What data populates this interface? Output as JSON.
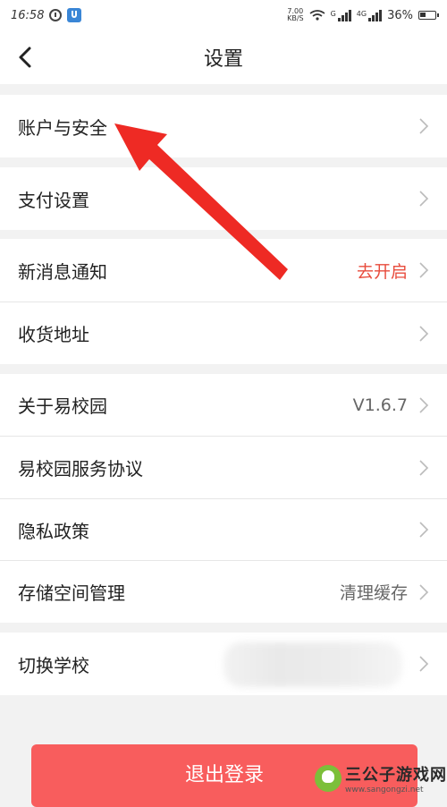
{
  "status_bar": {
    "time": "16:58",
    "net_speed": "7.00",
    "net_unit": "KB/S",
    "sig1": "G",
    "sig2": "4G",
    "battery": "36%"
  },
  "header": {
    "title": "设置"
  },
  "groups": [
    [
      {
        "label": "账户与安全",
        "value": ""
      }
    ],
    [
      {
        "label": "支付设置",
        "value": ""
      }
    ],
    [
      {
        "label": "新消息通知",
        "value": "去开启"
      },
      {
        "label": "收货地址",
        "value": ""
      }
    ],
    [
      {
        "label": "关于易校园",
        "value": "V1.6.7"
      },
      {
        "label": "易校园服务协议",
        "value": ""
      },
      {
        "label": "隐私政策",
        "value": ""
      },
      {
        "label": "存储空间管理",
        "value": "清理缓存"
      }
    ],
    [
      {
        "label": "切换学校",
        "value": ""
      }
    ]
  ],
  "logout": {
    "label": "退出登录"
  },
  "watermark": {
    "name": "三公子游戏网",
    "url": "www.sangongzi.net"
  },
  "colors": {
    "accent_red": "#e84c3d",
    "logout_bg": "#f85d5d",
    "arrow": "#ee2a24"
  }
}
